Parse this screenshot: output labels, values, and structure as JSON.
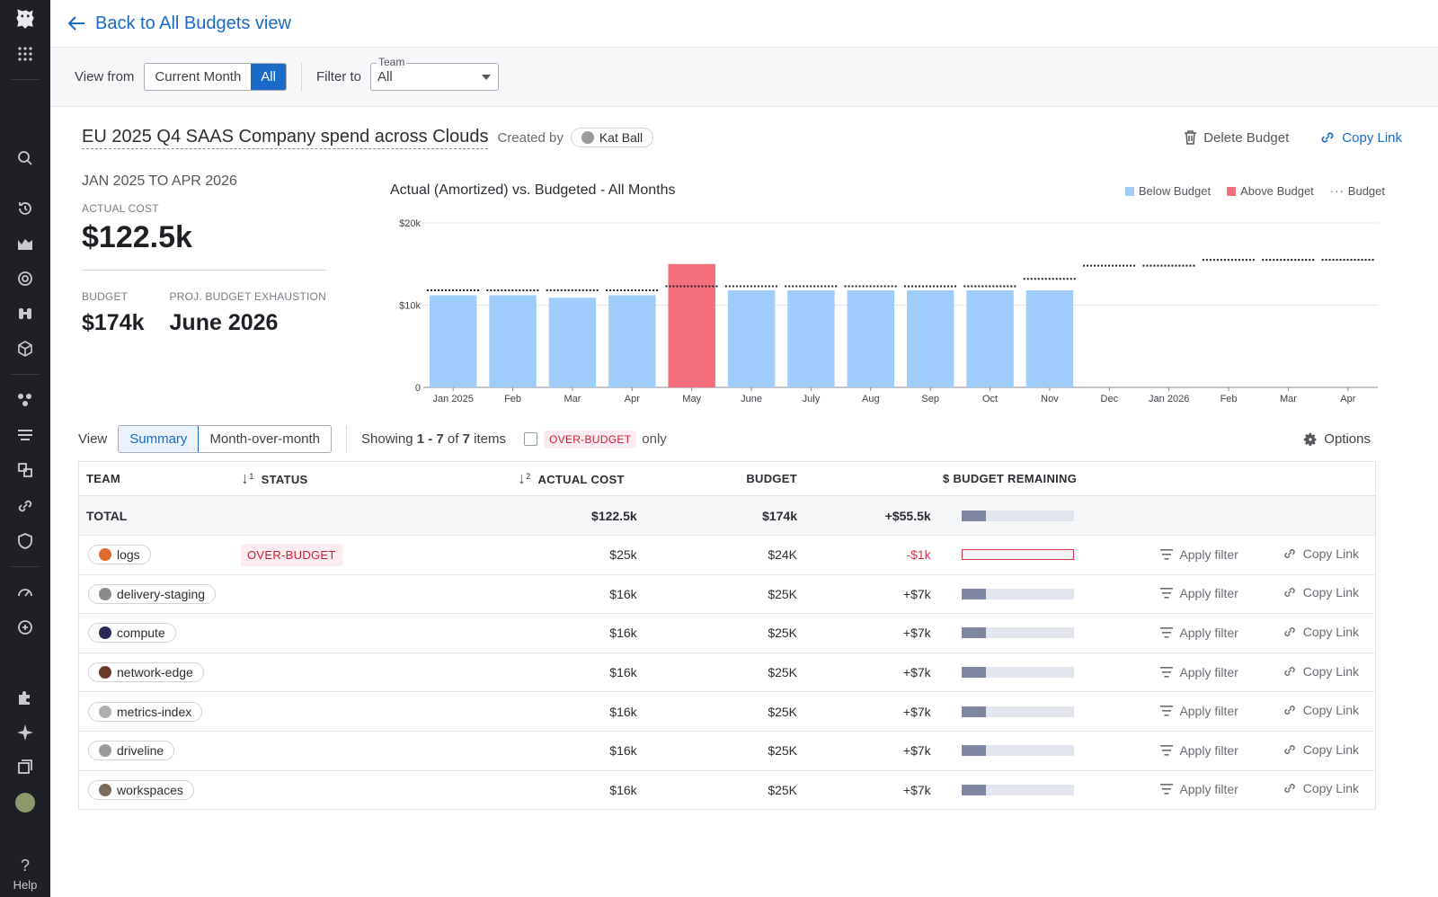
{
  "nav": {
    "help_label": "Help"
  },
  "header": {
    "back_label": "Back to All Budgets view"
  },
  "filters": {
    "view_from_label": "View from",
    "view_options": [
      "Current Month",
      "All"
    ],
    "view_selected": "All",
    "filter_to_label": "Filter to",
    "team_legend": "Team",
    "team_value": "All"
  },
  "budget": {
    "title": "EU 2025 Q4 SAAS Company spend across Clouds",
    "created_by_label": "Created by",
    "creator": "Kat Ball",
    "delete_label": "Delete Budget",
    "copy_link_label": "Copy Link"
  },
  "stats": {
    "range_start": "JAN 2025",
    "range_to": "TO",
    "range_end": "APR 2026",
    "actual_cost_label": "ACTUAL COST",
    "actual_cost": "$122.5k",
    "budget_label": "BUDGET",
    "budget_value": "$174k",
    "exhaustion_label": "PROJ. BUDGET EXHAUSTION",
    "exhaustion_value": "June 2026"
  },
  "chart_data": {
    "type": "bar",
    "title": "Actual (Amortized) vs. Budgeted - All Months",
    "legend": [
      "Below Budget",
      "Above Budget",
      "Budget"
    ],
    "legend_position": "top-right",
    "colors": {
      "below": "#9fcdfb",
      "above": "#f46e7c",
      "budget": "#1f1f26"
    },
    "categories": [
      "Jan 2025",
      "Feb",
      "Mar",
      "Apr",
      "May",
      "June",
      "July",
      "Aug",
      "Sep",
      "Oct",
      "Nov",
      "Dec",
      "Jan 2026",
      "Feb",
      "Mar",
      "Apr"
    ],
    "yticks": [
      "0",
      "$10k",
      "$20k"
    ],
    "ylim": [
      0,
      20000
    ],
    "series": [
      {
        "name": "Actual",
        "values": [
          11200,
          11200,
          10900,
          11200,
          15000,
          11800,
          11800,
          11800,
          11800,
          11800,
          11800,
          null,
          null,
          null,
          null,
          null
        ]
      },
      {
        "name": "Budget",
        "values": [
          11800,
          11800,
          11800,
          11800,
          12300,
          12300,
          12300,
          12300,
          12300,
          12300,
          13200,
          14800,
          14800,
          15500,
          15500,
          15500
        ]
      }
    ],
    "above_budget_index": [
      4
    ]
  },
  "table_controls": {
    "view_label": "View",
    "views": [
      "Summary",
      "Month-over-month"
    ],
    "view_selected": "Summary",
    "showing_prefix": "Showing",
    "showing_range": "1 - 7",
    "showing_of": "of",
    "showing_count": "7",
    "showing_suffix": "items",
    "over_budget_tag": "OVER-BUDGET",
    "only_label": "only",
    "options_label": "Options"
  },
  "table": {
    "headers": {
      "team": "TEAM",
      "status": "STATUS",
      "status_sort": "1",
      "actual": "ACTUAL COST",
      "actual_sort": "2",
      "budget": "BUDGET",
      "remaining": "$ BUDGET REMAINING"
    },
    "total": {
      "label": "TOTAL",
      "actual": "$122.5k",
      "budget": "$174k",
      "remaining": "+$55.5k",
      "remaining_fraction": 0.22
    },
    "apply_filter_label": "Apply filter",
    "copy_link_label": "Copy Link",
    "rows": [
      {
        "team": "logs",
        "status": "OVER-BUDGET",
        "actual": "$25k",
        "budget": "$24K",
        "remaining": "-$1k",
        "remaining_fraction": 0,
        "avatar": "#e06b2a"
      },
      {
        "team": "delivery-staging",
        "status": "",
        "actual": "$16k",
        "budget": "$25K",
        "remaining": "+$7k",
        "remaining_fraction": 0.22,
        "avatar": "#8a8a8a"
      },
      {
        "team": "compute",
        "status": "",
        "actual": "$16k",
        "budget": "$25K",
        "remaining": "+$7k",
        "remaining_fraction": 0.22,
        "avatar": "#2a2a55"
      },
      {
        "team": "network-edge",
        "status": "",
        "actual": "$16k",
        "budget": "$25K",
        "remaining": "+$7k",
        "remaining_fraction": 0.22,
        "avatar": "#6a3a2a"
      },
      {
        "team": "metrics-index",
        "status": "",
        "actual": "$16k",
        "budget": "$25K",
        "remaining": "+$7k",
        "remaining_fraction": 0.22,
        "avatar": "#b0b0b0"
      },
      {
        "team": "driveline",
        "status": "",
        "actual": "$16k",
        "budget": "$25K",
        "remaining": "+$7k",
        "remaining_fraction": 0.22,
        "avatar": "#9a9a9a"
      },
      {
        "team": "workspaces",
        "status": "",
        "actual": "$16k",
        "budget": "$25K",
        "remaining": "+$7k",
        "remaining_fraction": 0.22,
        "avatar": "#7a6a5a"
      }
    ]
  }
}
